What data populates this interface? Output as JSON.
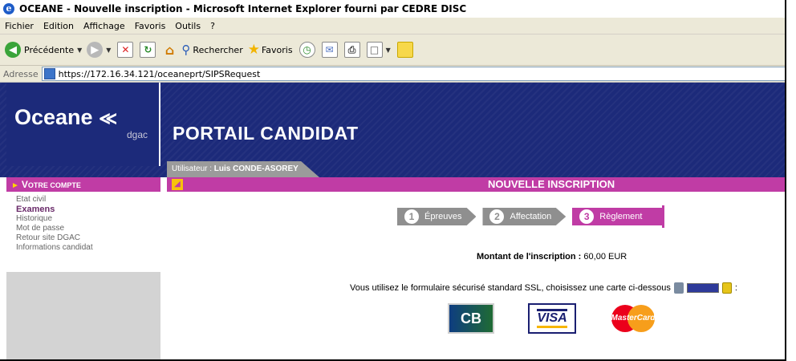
{
  "window": {
    "title": "OCEANE - Nouvelle inscription - Microsoft Internet Explorer fourni par CEDRE DISC"
  },
  "menubar": {
    "items": [
      "Fichier",
      "Edition",
      "Affichage",
      "Favoris",
      "Outils",
      "?"
    ]
  },
  "toolbar": {
    "back_label": "Précédente",
    "search_label": "Rechercher",
    "favorites_label": "Favoris"
  },
  "address": {
    "label": "Adresse",
    "url": "https://172.16.34.121/oceaneprt/SIPSRequest"
  },
  "site": {
    "logo": "Oceane",
    "logo_sub": "dgac",
    "portal_title": "PORTAIL CANDIDAT",
    "user_label": "Utilisateur :",
    "user_name": "Luis CONDE-ASOREY"
  },
  "sidebar": {
    "heading_first": "V",
    "heading_rest": "OTRE COMPTE",
    "items": [
      "Etat civil",
      "Examens",
      "Historique",
      "Mot de passe",
      "Retour site DGAC",
      "Informations candidat"
    ]
  },
  "main": {
    "header_title": "NOUVELLE INSCRIPTION",
    "steps": [
      {
        "num": "1",
        "label": "Épreuves"
      },
      {
        "num": "2",
        "label": "Affectation"
      },
      {
        "num": "3",
        "label": "Règlement"
      }
    ],
    "amount_label": "Montant de l'inscription :",
    "amount_value": "60,00 EUR",
    "ssl_text": "Vous utilisez le formulaire sécurisé standard SSL, choisissez une carte ci-dessous",
    "ssl_suffix": ":",
    "cards": {
      "cb": "CB",
      "visa": "VISA",
      "mastercard": "MasterCard"
    }
  },
  "colors": {
    "banner": "#1c2a7a",
    "accent": "#c03ca5",
    "step_inactive": "#8f8f8f"
  }
}
